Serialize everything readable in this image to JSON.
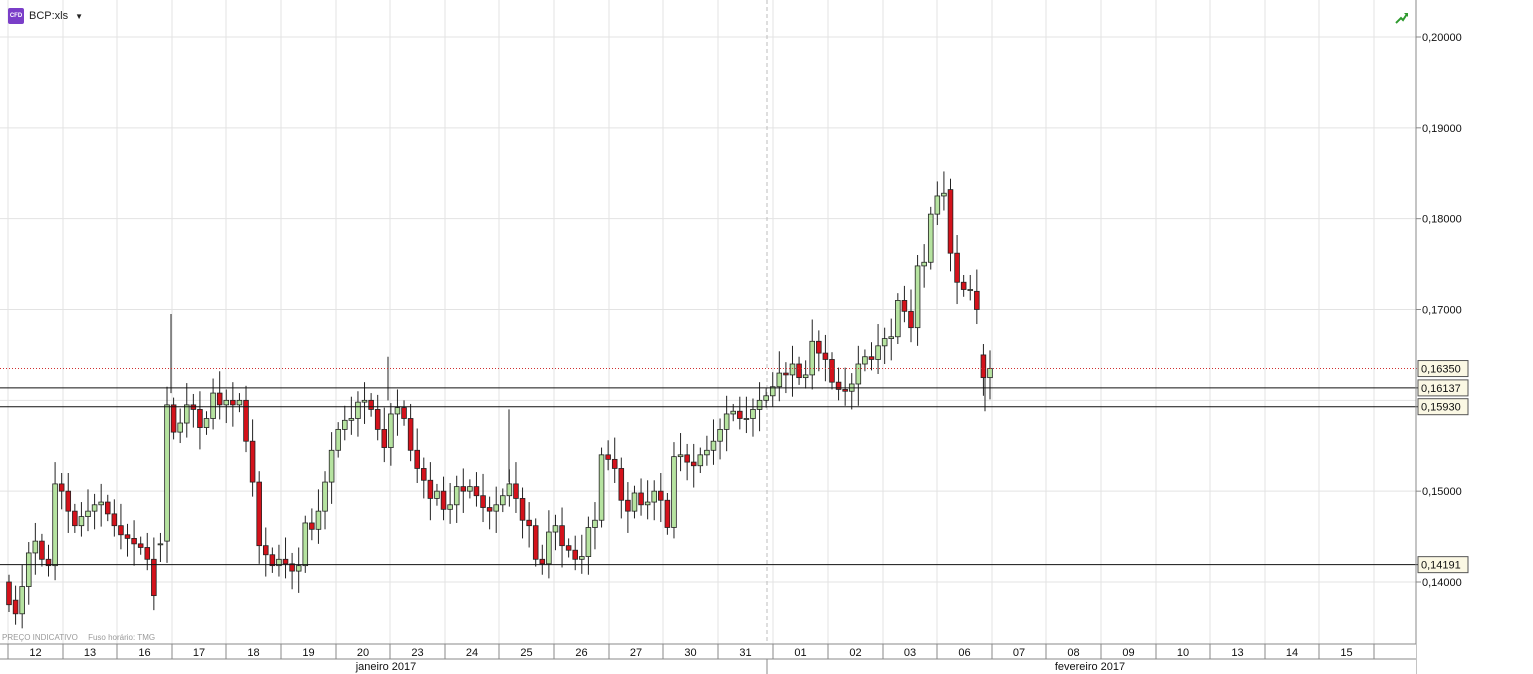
{
  "header": {
    "symbol": "BCP:xls",
    "badge": "CFD"
  },
  "footer": {
    "price_note": "PREÇO INDICATIVO",
    "timezone_note": "Fuso horário: TMG"
  },
  "colors": {
    "up": "#b6e3a0",
    "down": "#d4121b",
    "grid": "#e3e3e3",
    "price_line": "#d03030"
  },
  "icons": {
    "trend": "trend-up-icon",
    "dropdown": "chevron-down-icon"
  },
  "chart_data": {
    "type": "candlestick",
    "ylim": [
      0.1315,
      0.2045
    ],
    "y_ticks": [
      "0,20000",
      "0,19000",
      "0,18000",
      "0,17000",
      "0,15000",
      "0,14000"
    ],
    "y_tick_values": [
      0.2,
      0.19,
      0.18,
      0.17,
      0.15,
      0.14
    ],
    "price_labels": [
      {
        "value": 0.1635,
        "text": "0,16350",
        "style": "dotted"
      },
      {
        "value": 0.16137,
        "text": "0,16137",
        "style": "solid"
      },
      {
        "value": 0.1593,
        "text": "0,15930",
        "style": "solid"
      },
      {
        "value": 0.14191,
        "text": "0,14191",
        "style": "solid"
      }
    ],
    "x_ticks": [
      "12",
      "13",
      "16",
      "17",
      "18",
      "19",
      "20",
      "23",
      "24",
      "25",
      "26",
      "27",
      "30",
      "31",
      "01",
      "02",
      "03",
      "06",
      "07",
      "08",
      "09",
      "10",
      "13",
      "14",
      "15"
    ],
    "months": [
      "janeiro 2017",
      "fevereiro 2017"
    ],
    "candles_per_day": [
      9,
      9,
      9,
      9,
      9,
      9,
      9,
      9,
      9,
      9,
      9,
      9,
      9,
      9,
      9,
      9,
      9,
      9
    ],
    "close": [
      0.1375,
      0.1365,
      0.1395,
      0.1432,
      0.1445,
      0.1425,
      0.1418,
      0.1508,
      0.15,
      0.1478,
      0.1462,
      0.1472,
      0.1478,
      0.1485,
      0.1488,
      0.1475,
      0.1462,
      0.1452,
      0.1448,
      0.1442,
      0.1438,
      0.1425,
      0.1385,
      0.1442,
      0.1595,
      0.1565,
      0.1575,
      0.1595,
      0.159,
      0.157,
      0.158,
      0.1608,
      0.1595,
      0.16,
      0.1595,
      0.16,
      0.1555,
      0.151,
      0.144,
      0.143,
      0.1418,
      0.1425,
      0.142,
      0.1412,
      0.1418,
      0.1465,
      0.1458,
      0.1478,
      0.151,
      0.1545,
      0.1568,
      0.1578,
      0.158,
      0.1598,
      0.16,
      0.159,
      0.1568,
      0.1548,
      0.1585,
      0.1592,
      0.158,
      0.1545,
      0.1525,
      0.1512,
      0.1492,
      0.15,
      0.148,
      0.1485,
      0.1505,
      0.15,
      0.1505,
      0.1495,
      0.1482,
      0.1478,
      0.1485,
      0.1495,
      0.1508,
      0.1492,
      0.1468,
      0.1462,
      0.1425,
      0.142,
      0.1455,
      0.1462,
      0.144,
      0.1435,
      0.1425,
      0.1428,
      0.146,
      0.1468,
      0.154,
      0.1535,
      0.1525,
      0.149,
      0.1478,
      0.1498,
      0.1485,
      0.1488,
      0.15,
      0.149,
      0.146,
      0.1538,
      0.154,
      0.1532,
      0.1528,
      0.154,
      0.1545,
      0.1555,
      0.1568,
      0.1585,
      0.1588,
      0.158,
      0.158,
      0.159,
      0.16,
      0.1605,
      0.1615,
      0.163,
      0.1628,
      0.164,
      0.1625,
      0.1628,
      0.1665,
      0.1652,
      0.1645,
      0.162,
      0.1612,
      0.161,
      0.1618,
      0.164,
      0.1648,
      0.1645,
      0.166,
      0.1668,
      0.167,
      0.171,
      0.1698,
      0.168,
      0.1748,
      0.1752,
      0.1805,
      0.1825,
      0.1828,
      0.1762,
      0.173,
      0.1722,
      0.1722,
      0.17,
      0.1625,
      0.1635
    ],
    "open": [
      0.14,
      0.138,
      0.1365,
      0.1395,
      0.1432,
      0.1445,
      0.1425,
      0.1418,
      0.1508,
      0.15,
      0.1478,
      0.1462,
      0.1472,
      0.1478,
      0.1485,
      0.1488,
      0.1475,
      0.1462,
      0.1452,
      0.1448,
      0.1442,
      0.1438,
      0.1425,
      0.1442,
      0.1445,
      0.1595,
      0.1565,
      0.1575,
      0.1595,
      0.159,
      0.157,
      0.158,
      0.1608,
      0.1595,
      0.16,
      0.1595,
      0.16,
      0.1555,
      0.151,
      0.144,
      0.143,
      0.1418,
      0.1425,
      0.142,
      0.1412,
      0.1418,
      0.1465,
      0.1458,
      0.1478,
      0.151,
      0.1545,
      0.1568,
      0.1578,
      0.158,
      0.1598,
      0.16,
      0.159,
      0.1568,
      0.1548,
      0.1585,
      0.1592,
      0.158,
      0.1545,
      0.1525,
      0.1512,
      0.1492,
      0.15,
      0.148,
      0.1485,
      0.1505,
      0.15,
      0.1505,
      0.1495,
      0.1482,
      0.1478,
      0.1485,
      0.1495,
      0.1508,
      0.1492,
      0.1468,
      0.1462,
      0.1425,
      0.142,
      0.1455,
      0.1462,
      0.144,
      0.1435,
      0.1425,
      0.1428,
      0.146,
      0.1468,
      0.154,
      0.1535,
      0.1525,
      0.149,
      0.1478,
      0.1498,
      0.1485,
      0.1488,
      0.15,
      0.149,
      0.146,
      0.1538,
      0.154,
      0.1532,
      0.1528,
      0.154,
      0.1545,
      0.1555,
      0.1568,
      0.1585,
      0.1588,
      0.158,
      0.158,
      0.159,
      0.16,
      0.1605,
      0.1615,
      0.163,
      0.1628,
      0.164,
      0.1625,
      0.1628,
      0.1665,
      0.1652,
      0.1645,
      0.162,
      0.1612,
      0.161,
      0.1618,
      0.164,
      0.1648,
      0.1645,
      0.166,
      0.1668,
      0.167,
      0.171,
      0.1698,
      0.168,
      0.1748,
      0.1752,
      0.1805,
      0.1825,
      0.1832,
      0.1762,
      0.173,
      0.1722,
      0.172,
      0.165,
      0.1625
    ]
  }
}
